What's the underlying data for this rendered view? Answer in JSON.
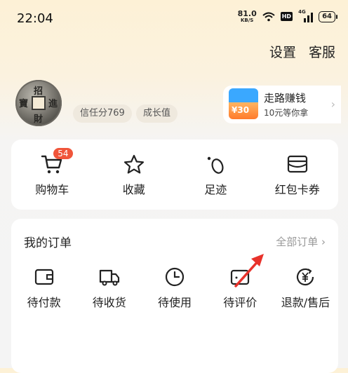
{
  "status_bar": {
    "time": "22:04",
    "net_speed": "81.0",
    "net_unit": "KB/S",
    "hd": "HD",
    "signal": "4G",
    "battery": "64"
  },
  "top_links": [
    "设置",
    "客服"
  ],
  "profile": {
    "avatar_chars": [
      "招",
      "財",
      "進",
      "寶"
    ],
    "credit": "信任分769",
    "growth": "成长值"
  },
  "promo": {
    "title": "走路赚钱",
    "subtitle": "10元等你拿",
    "tag": "¥30"
  },
  "quick": [
    {
      "label": "购物车",
      "icon": "cart-icon",
      "badge": "54"
    },
    {
      "label": "收藏",
      "icon": "star-icon"
    },
    {
      "label": "足迹",
      "icon": "footprint-icon"
    },
    {
      "label": "红包卡券",
      "icon": "wallet-card-icon"
    }
  ],
  "orders": {
    "title": "我的订单",
    "all_label": "全部订单",
    "items": [
      {
        "label": "待付款",
        "icon": "wallet-icon"
      },
      {
        "label": "待收货",
        "icon": "truck-icon"
      },
      {
        "label": "待使用",
        "icon": "clock-icon"
      },
      {
        "label": "待评价",
        "icon": "review-icon"
      },
      {
        "label": "退款/售后",
        "icon": "refund-yen-icon"
      }
    ]
  },
  "colors": {
    "accent": "#f0553a",
    "annotation_arrow": "#e8322b"
  }
}
